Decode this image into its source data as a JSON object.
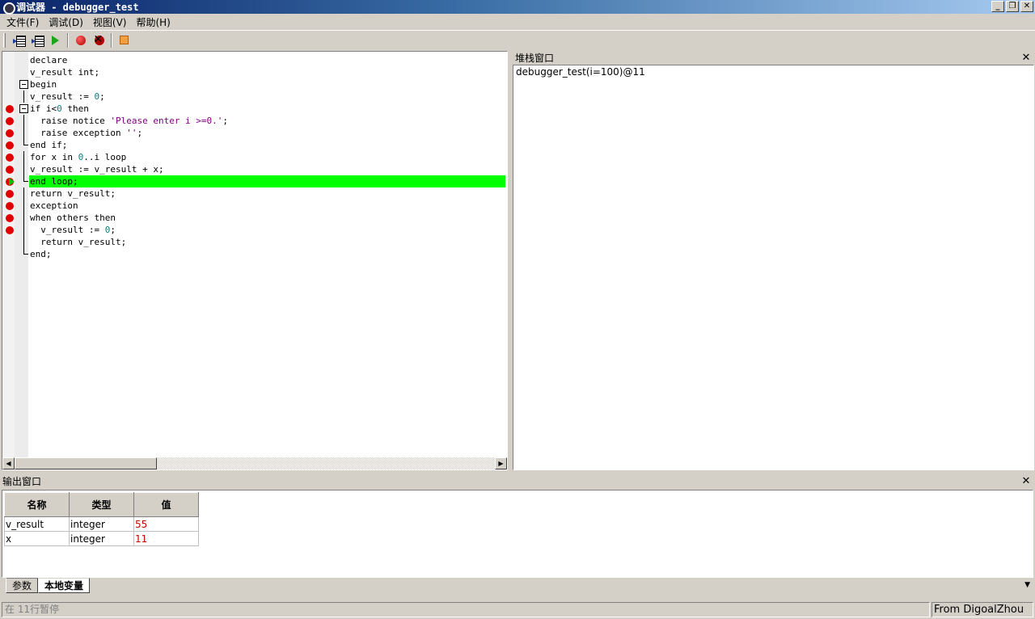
{
  "window": {
    "title": "调试器 - debugger_test",
    "minimize": "_",
    "restore": "❐",
    "close": "✕"
  },
  "menu": [
    "文件(F)",
    "调试(D)",
    "视图(V)",
    "帮助(H)"
  ],
  "toolbar": {
    "icons": [
      "step-into-icon",
      "step-over-icon",
      "continue-icon",
      "set-breakpoint-icon",
      "clear-breakpoints-icon",
      "stop-icon"
    ]
  },
  "editor": {
    "current_line": 11,
    "lines": [
      {
        "text": "declare",
        "breakpoint": false,
        "fold": "none"
      },
      {
        "text": "v_result int;",
        "breakpoint": false,
        "fold": "none"
      },
      {
        "text": "begin",
        "breakpoint": false,
        "fold": "start"
      },
      {
        "text": "v_result := 0;",
        "breakpoint": false,
        "fold": "line"
      },
      {
        "text": "if i<0 then",
        "breakpoint": true,
        "fold": "start"
      },
      {
        "text": "  raise notice 'Please enter i >=0.';",
        "breakpoint": true,
        "fold": "line"
      },
      {
        "text": "  raise exception '';",
        "breakpoint": true,
        "fold": "line"
      },
      {
        "text": "end if;",
        "breakpoint": true,
        "fold": "end"
      },
      {
        "text": "for x in 0..i loop",
        "breakpoint": true,
        "fold": "line"
      },
      {
        "text": "v_result := v_result + x;",
        "breakpoint": true,
        "fold": "line"
      },
      {
        "text": "end loop;",
        "breakpoint": true,
        "fold": "end"
      },
      {
        "text": "return v_result;",
        "breakpoint": true,
        "fold": "line"
      },
      {
        "text": "exception",
        "breakpoint": true,
        "fold": "line"
      },
      {
        "text": "when others then",
        "breakpoint": true,
        "fold": "line"
      },
      {
        "text": "  v_result := 0;",
        "breakpoint": true,
        "fold": "line"
      },
      {
        "text": "  return v_result;",
        "breakpoint": false,
        "fold": "line"
      },
      {
        "text": "end;",
        "breakpoint": false,
        "fold": "end"
      }
    ]
  },
  "stack": {
    "title": "堆栈窗口",
    "entries": [
      "debugger_test(i=100)@11"
    ]
  },
  "output": {
    "title": "输出窗口",
    "columns": [
      "名称",
      "类型",
      "值"
    ],
    "rows": [
      {
        "name": "v_result",
        "type": "integer",
        "value": "55"
      },
      {
        "name": "x",
        "type": "integer",
        "value": "11"
      }
    ],
    "tabs": [
      {
        "label": "参数",
        "active": false
      },
      {
        "label": "本地变量",
        "active": true
      }
    ]
  },
  "status": {
    "message": "在 11行暂停",
    "credit": "From DigoalZhou"
  },
  "colors": {
    "current_line": "#00ff00",
    "breakpoint": "#e00000",
    "number": "#0a8080",
    "string": "#800080",
    "value": "#c00000"
  }
}
